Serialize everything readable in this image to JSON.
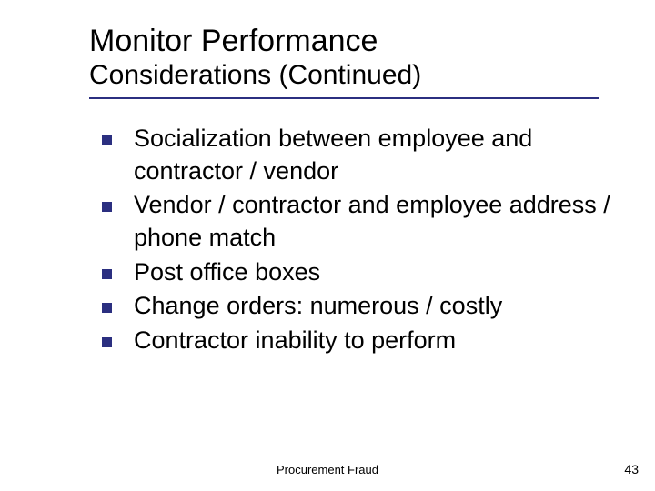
{
  "title": {
    "main": "Monitor Performance",
    "sub": "Considerations (Continued)"
  },
  "bullets": [
    "Socialization between employee and contractor / vendor",
    "Vendor / contractor and employee address / phone match",
    "Post office boxes",
    "Change orders: numerous / costly",
    "Contractor inability to perform"
  ],
  "footer": {
    "center": "Procurement Fraud",
    "page": "43"
  },
  "colors": {
    "accent": "#2b2f80"
  }
}
